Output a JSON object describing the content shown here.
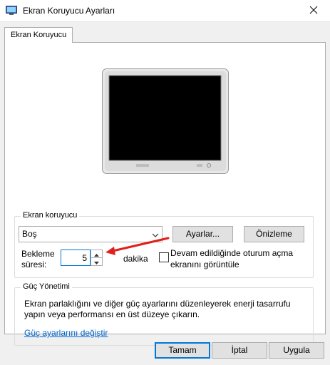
{
  "window": {
    "title": "Ekran Koruyucu Ayarları",
    "close_icon": "close-icon",
    "app_icon": "screensaver-app-icon"
  },
  "tab": {
    "label": "Ekran Koruyucu"
  },
  "screensaver": {
    "group_label": "Ekran koruyucu",
    "selected": "Boş",
    "settings_button": "Ayarlar...",
    "preview_button": "Önizleme",
    "wait_label_line1": "Bekleme",
    "wait_label_line2": "süresi:",
    "wait_value": "5",
    "unit_label": "dakika",
    "resume_checkbox_line1": "Devam edildiğinde oturum açma",
    "resume_checkbox_line2": "ekranını görüntüle",
    "resume_checked": false
  },
  "power": {
    "group_label": "Güç Yönetimi",
    "description_line1": "Ekran parlaklığını ve diğer güç ayarlarını düzenleyerek enerji tasarrufu",
    "description_line2": "yapın veya performansı en üst düzeye çıkarın.",
    "link": "Güç ayarlarını değiştir"
  },
  "footer": {
    "ok": "Tamam",
    "cancel": "İptal",
    "apply": "Uygula"
  },
  "colors": {
    "accent": "#0078d7",
    "annotation_arrow": "#e0201b",
    "link": "#0066cc"
  }
}
